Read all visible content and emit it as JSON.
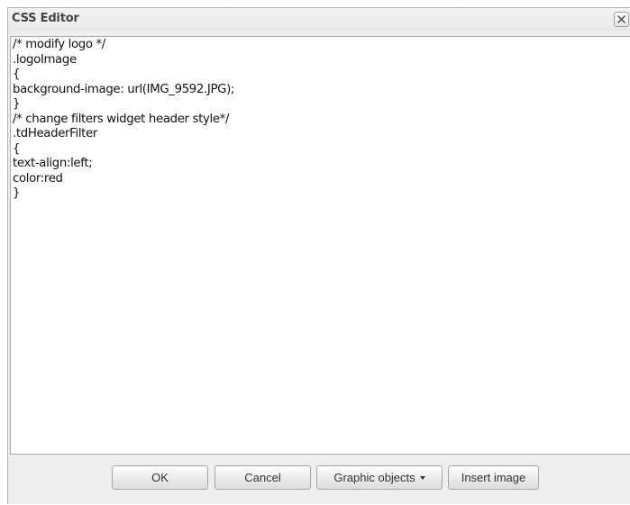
{
  "dialog": {
    "title": "CSS Editor",
    "close_icon": "close-icon"
  },
  "editor": {
    "lines": [
      "/* modify logo */",
      ".logoImage",
      "{",
      "background-image: url(IMG_9592.JPG);",
      "}",
      "/* change filters widget header style*/",
      ".tdHeaderFilter",
      "{",
      "text-align:left;",
      "color:red",
      "}"
    ]
  },
  "buttons": {
    "ok": "OK",
    "cancel": "Cancel",
    "graphic_objects": "Graphic objects",
    "insert_image": "Insert image"
  }
}
